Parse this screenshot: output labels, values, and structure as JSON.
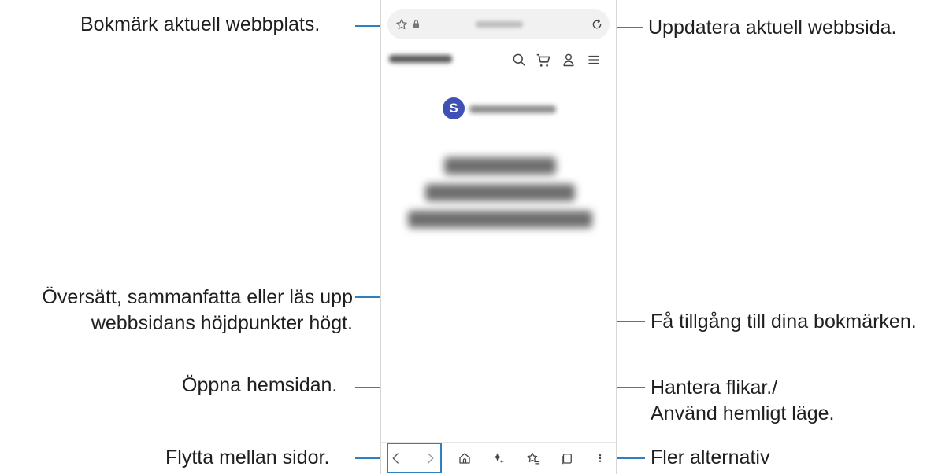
{
  "callouts": {
    "bookmark_site": "Bokmärk aktuell webbplats.",
    "refresh_page": "Uppdatera aktuell webbsida.",
    "translate_line1": "Översätt, sammanfatta eller läs upp",
    "translate_line2": "webbsidans höjdpunkter högt.",
    "bookmarks_access": "Få tillgång till dina bokmärken.",
    "open_home": "Öppna hemsidan.",
    "tabs_line1": "Hantera flikar./",
    "tabs_line2": "Använd hemligt läge.",
    "move_pages": "Flytta mellan sidor.",
    "more_options": "Fler alternativ"
  },
  "browser": {
    "site_logo_letter": "S",
    "icons": {
      "url_left": [
        "star-outline-icon",
        "lock-icon"
      ],
      "url_right": "refresh-icon",
      "site_header": [
        "search-icon",
        "cart-icon",
        "user-icon",
        "menu-icon"
      ],
      "navbar": [
        "back-icon",
        "forward-icon",
        "home-icon",
        "ai-sparkle-icon",
        "bookmarks-icon",
        "tabs-icon",
        "more-options-icon"
      ]
    }
  },
  "colors": {
    "accent_line": "#2f7fc1",
    "logo_blue": "#3f51b5"
  }
}
